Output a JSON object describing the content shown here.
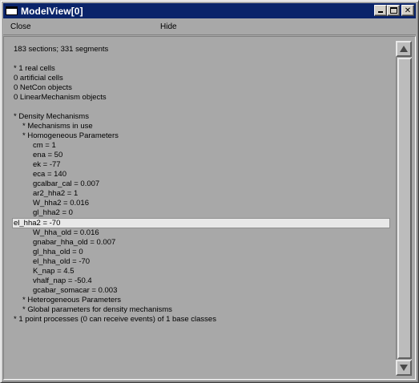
{
  "window": {
    "title": "ModelView[0]"
  },
  "menu": {
    "close_label": "Close",
    "hide_label": "Hide"
  },
  "tree": {
    "rows": [
      "183 sections; 331 segments",
      "",
      "* 1 real cells",
      "0 artificial cells",
      "0 NetCon objects",
      "0 LinearMechanism objects",
      "",
      "* Density Mechanisms",
      "* Mechanisms in use",
      "* Homogeneous Parameters",
      "cm = 1",
      "ena = 50",
      "ek = -77",
      "eca = 140",
      "gcalbar_cal = 0.007",
      "ar2_hha2 = 1",
      "W_hha2 = 0.016",
      "gl_hha2 = 0",
      "el_hha2 = -70",
      "W_hha_old = 0.016",
      "gnabar_hha_old = 0.007",
      "gl_hha_old = 0",
      "el_hha_old = -70",
      "K_nap = 4.5",
      "vhalf_nap = -50.4",
      "gcabar_somacar = 0.003",
      "* Heterogeneous Parameters",
      "* Global parameters for density mechanisms",
      "* 1 point processes (0 can receive events) of 1 base classes"
    ],
    "selected_row": "el_hha2 = -70"
  },
  "icons": {
    "app": "window-icon",
    "minimize": "minimize-icon",
    "maximize": "maximize-icon",
    "close": "close-icon",
    "scroll_up": "arrow-up-icon",
    "scroll_down": "arrow-down-icon"
  },
  "colors": {
    "titlebar": "#0a246a",
    "panel": "#a8a8a8",
    "selection": "#e8e8e8"
  }
}
